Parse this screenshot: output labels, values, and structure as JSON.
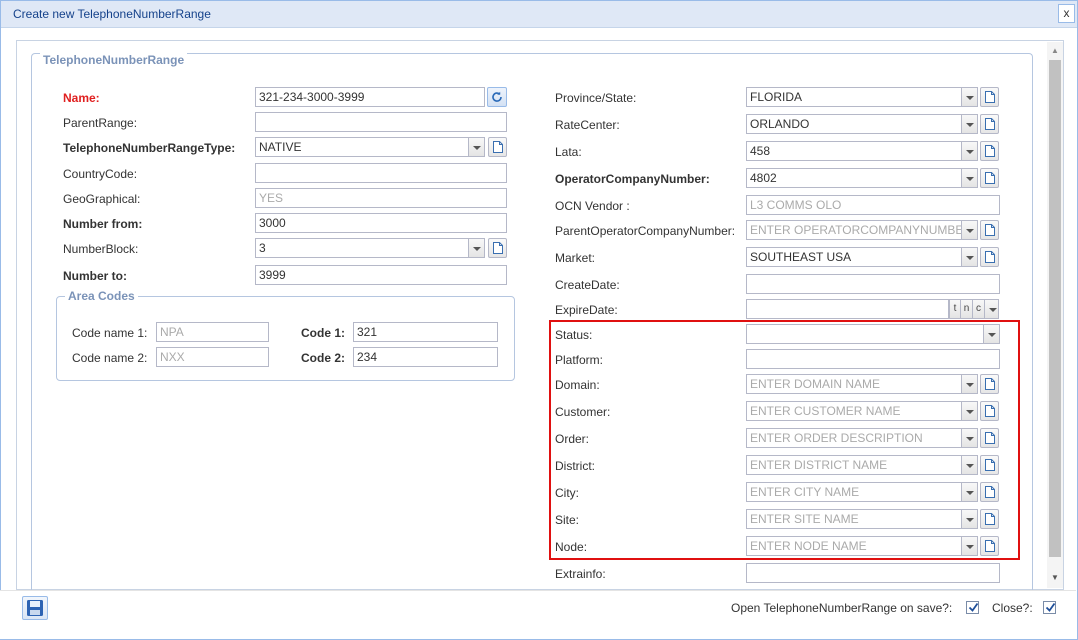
{
  "window": {
    "title": "Create new TelephoneNumberRange",
    "close_label": "x"
  },
  "fieldset": {
    "legend": "TelephoneNumberRange"
  },
  "left": {
    "name": {
      "label": "Name:",
      "value": "321-234-3000-3999"
    },
    "parent_range": {
      "label": "ParentRange:",
      "value": ""
    },
    "type": {
      "label": "TelephoneNumberRangeType:",
      "value": "NATIVE"
    },
    "country_code": {
      "label": "CountryCode:",
      "value": ""
    },
    "geographical": {
      "label": "GeoGraphical:",
      "value": "YES"
    },
    "number_from": {
      "label": "Number from:",
      "value": "3000"
    },
    "number_block": {
      "label": "NumberBlock:",
      "value": "3"
    },
    "number_to": {
      "label": "Number to:",
      "value": "3999"
    }
  },
  "area_codes": {
    "legend": "Area Codes",
    "code_name_1": {
      "label": "Code name 1:",
      "value": "NPA"
    },
    "code_name_2": {
      "label": "Code name 2:",
      "value": "NXX"
    },
    "code_1": {
      "label": "Code 1:",
      "value": "321"
    },
    "code_2": {
      "label": "Code 2:",
      "value": "234"
    }
  },
  "right": {
    "province": {
      "label": "Province/State:",
      "value": "FLORIDA"
    },
    "rate_center": {
      "label": "RateCenter:",
      "value": "ORLANDO"
    },
    "lata": {
      "label": "Lata:",
      "value": "458"
    },
    "ocn": {
      "label": "OperatorCompanyNumber:",
      "value": "4802"
    },
    "ocn_vendor": {
      "label": "OCN Vendor :",
      "value": "L3 COMMS OLO"
    },
    "parent_ocn": {
      "label": "ParentOperatorCompanyNumber:",
      "placeholder": "ENTER OPERATORCOMPANYNUMBER C"
    },
    "market": {
      "label": "Market:",
      "value": "SOUTHEAST USA"
    },
    "create_date": {
      "label": "CreateDate:",
      "value": ""
    },
    "expire_date": {
      "label": "ExpireDate:",
      "value": "",
      "btn_t": "t",
      "btn_n": "n",
      "btn_c": "c"
    },
    "status": {
      "label": "Status:",
      "value": ""
    },
    "platform": {
      "label": "Platform:",
      "value": ""
    },
    "domain": {
      "label": "Domain:",
      "placeholder": "ENTER DOMAIN NAME"
    },
    "customer": {
      "label": "Customer:",
      "placeholder": "ENTER CUSTOMER NAME"
    },
    "order": {
      "label": "Order:",
      "placeholder": "ENTER ORDER DESCRIPTION"
    },
    "district": {
      "label": "District:",
      "placeholder": "ENTER DISTRICT NAME"
    },
    "city": {
      "label": "City:",
      "placeholder": "ENTER CITY NAME"
    },
    "site": {
      "label": "Site:",
      "placeholder": "ENTER SITE NAME"
    },
    "node": {
      "label": "Node:",
      "placeholder": "ENTER NODE NAME"
    },
    "extrainfo": {
      "label": "Extrainfo:",
      "value": ""
    }
  },
  "footer": {
    "open_on_save_label": "Open TelephoneNumberRange on save?:",
    "open_on_save_checked": true,
    "close_label": "Close?:",
    "close_checked": true
  },
  "colors": {
    "highlight_box": "#e01010",
    "required_label": "#e02020",
    "title_bar": "#dfe8f6"
  }
}
